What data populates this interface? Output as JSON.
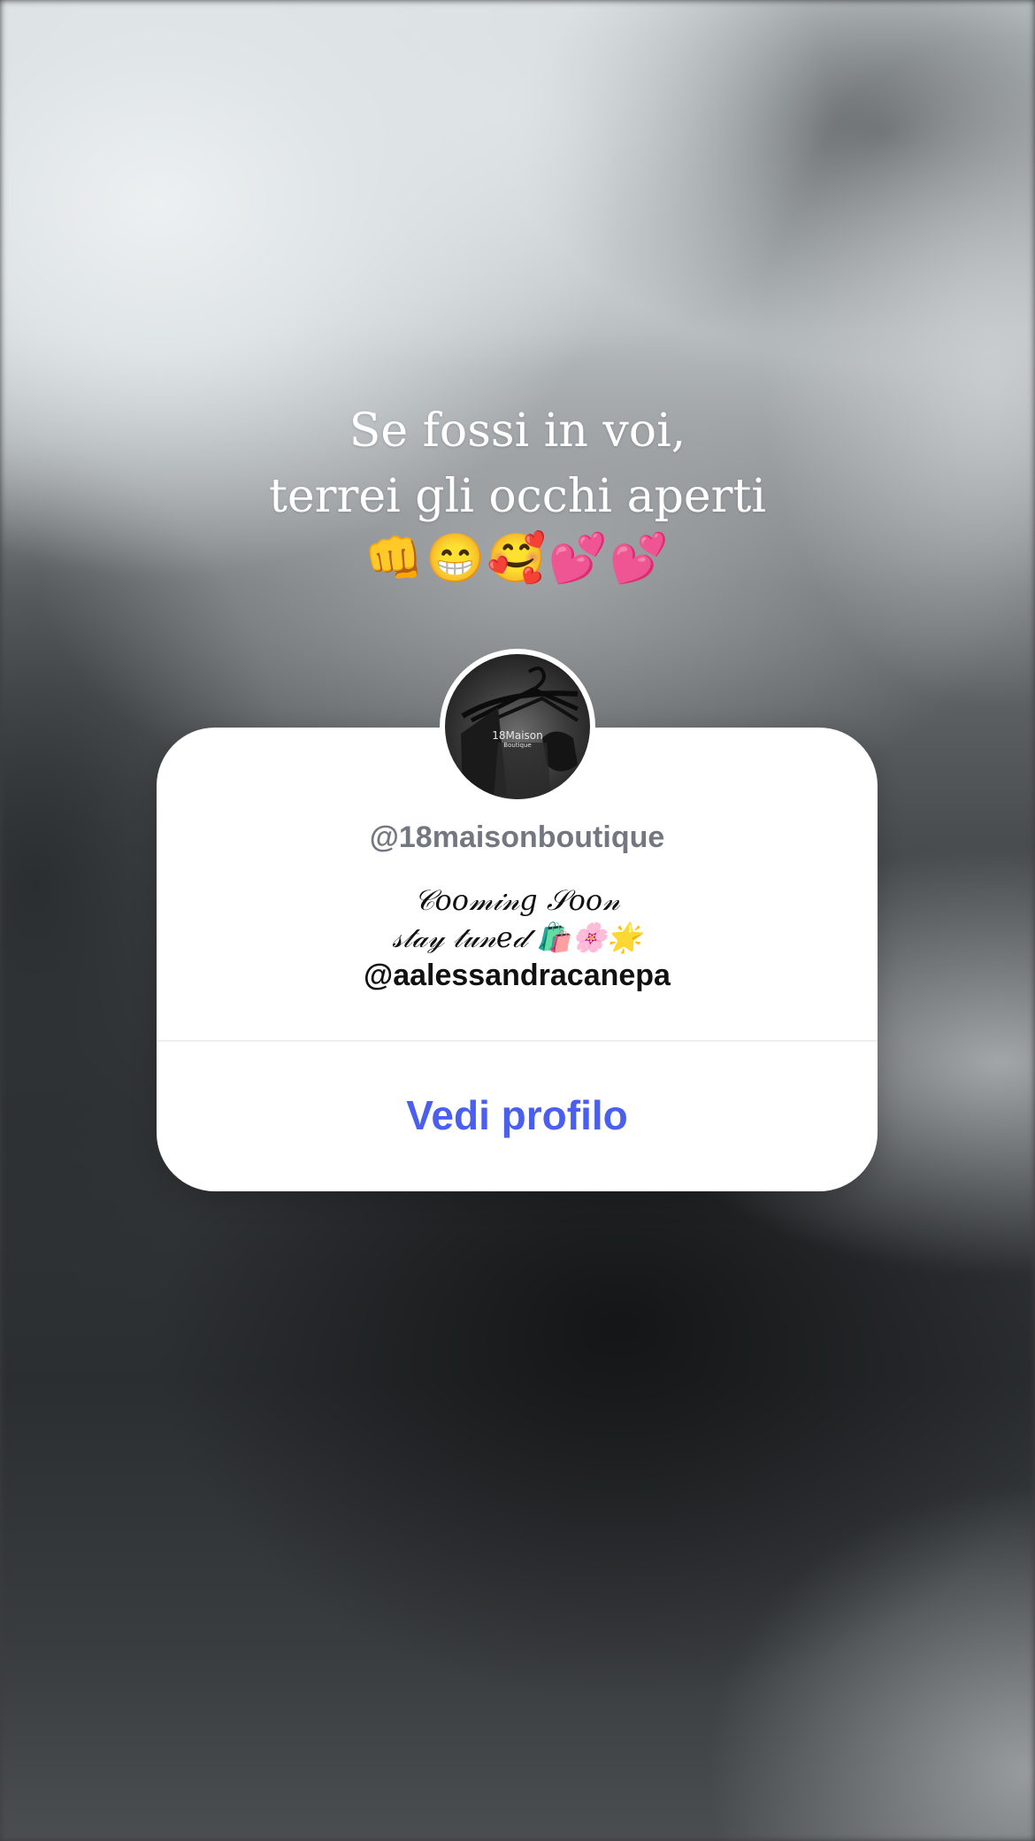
{
  "story": {
    "caption_lines": [
      "Se fossi in voi,",
      "terrei gli occhi aperti"
    ],
    "caption_emojis": "👊😁🥰💕💕"
  },
  "profile_card": {
    "avatar_logo_text": "18Maison",
    "avatar_logo_subtext": "Boutique",
    "username": "@18maisonboutique",
    "bio_line1": "𝒞𝑜𝑜𝓂𝒾𝓃𝑔 𝒮𝑜𝑜𝓃",
    "bio_line2": "𝓈𝓉𝒶𝓎 𝓉𝓊𝓃𝑒𝒹 🛍️🌸🌟",
    "bio_mention": "@aalessandracanepa",
    "button_label": "Vedi profilo"
  },
  "colors": {
    "button_text": "#4a5ff0",
    "username_text": "#737780",
    "card_background": "#ffffff"
  }
}
